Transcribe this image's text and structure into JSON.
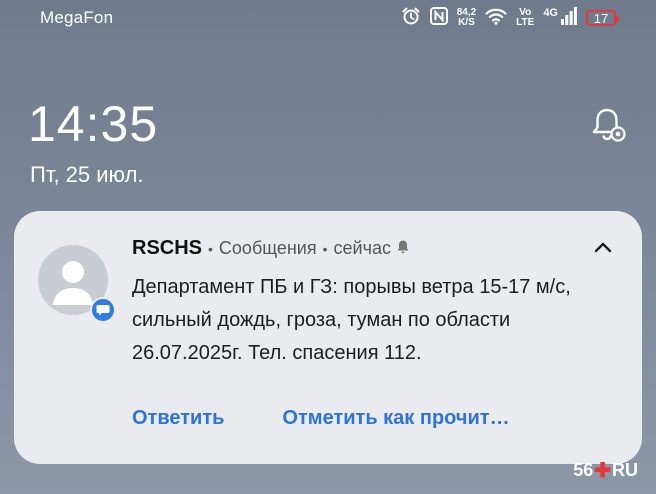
{
  "status_bar": {
    "carrier": "MegaFon",
    "net_speed_value": "84,2",
    "net_speed_unit": "K/S",
    "volte_top": "Vo",
    "volte_bottom": "LTE",
    "network": "4G",
    "battery": "17",
    "battery_color": "#e23a3a"
  },
  "lockscreen": {
    "time": "14:35",
    "date": "Пт, 25 июл."
  },
  "notification": {
    "sender": "RSCHS",
    "app": "Сообщения",
    "time": "сейчас",
    "text": "Департамент ПБ и ГЗ: порывы ветра 15-17 м/с, сильный дождь, гроза, туман по области 26.07.2025г. Тел. спасения 112.",
    "actions": {
      "reply": "Ответить",
      "mark_read": "Отметить как прочит…"
    },
    "accent_color": "#2f73d9"
  },
  "watermark": {
    "left": "56",
    "right": "RU"
  }
}
